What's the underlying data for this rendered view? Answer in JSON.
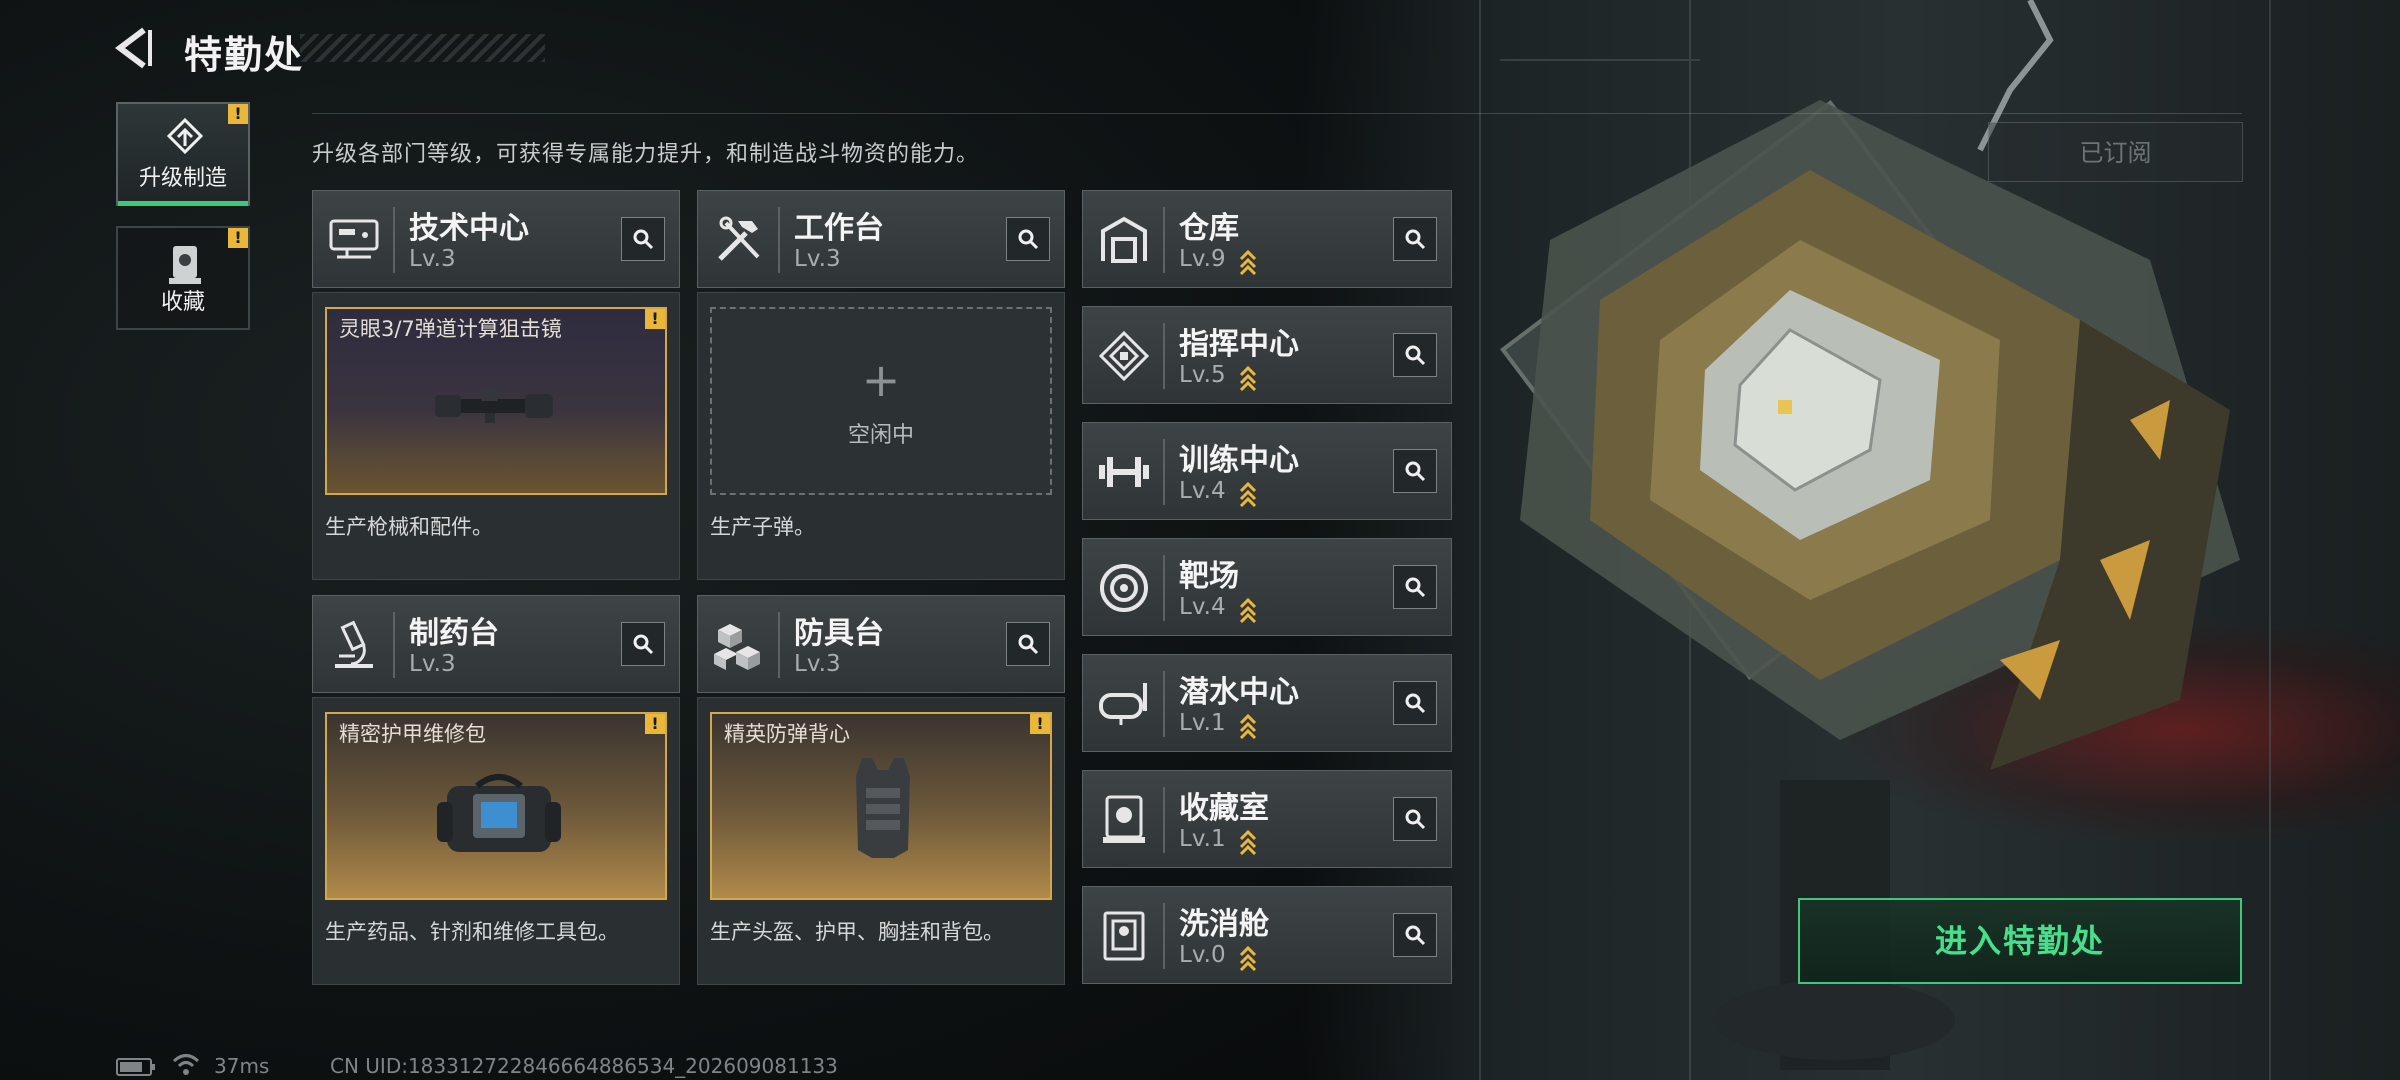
{
  "header": {
    "title": "特勤处"
  },
  "side_tabs": [
    {
      "label": "升级制造",
      "icon": "upgrade-icon",
      "active": true,
      "badge": "!"
    },
    {
      "label": "收藏",
      "icon": "collection-icon",
      "active": false,
      "badge": "!"
    }
  ],
  "hint": "升级各部门等级，可获得专属能力提升，和制造战斗物资的能力。",
  "subscribe_label": "已订阅",
  "departments_main": [
    {
      "name": "技术中心",
      "level": "Lv.3",
      "icon": "computer-terminal-icon",
      "slot": {
        "state": "crafting",
        "item_name": "灵眼3/7弹道计算狙击镜",
        "item_icon": "scope-icon",
        "badge": "!"
      },
      "desc": "生产枪械和配件。"
    },
    {
      "name": "工作台",
      "level": "Lv.3",
      "icon": "tools-icon",
      "slot": {
        "state": "idle",
        "plus": "+",
        "label": "空闲中"
      },
      "desc": "生产子弹。"
    },
    {
      "name": "制药台",
      "level": "Lv.3",
      "icon": "microscope-icon",
      "slot": {
        "state": "crafting",
        "item_name": "精密护甲维修包",
        "item_icon": "repair-kit-icon",
        "badge": "!"
      },
      "desc": "生产药品、针剂和维修工具包。"
    },
    {
      "name": "防具台",
      "level": "Lv.3",
      "icon": "cubes-icon",
      "slot": {
        "state": "crafting",
        "item_name": "精英防弹背心",
        "item_icon": "vest-icon",
        "badge": "!"
      },
      "desc": "生产头盔、护甲、胸挂和背包。"
    }
  ],
  "departments_list": [
    {
      "name": "仓库",
      "level": "Lv.9",
      "icon": "warehouse-icon"
    },
    {
      "name": "指挥中心",
      "level": "Lv.5",
      "icon": "command-center-icon"
    },
    {
      "name": "训练中心",
      "level": "Lv.4",
      "icon": "dumbbell-icon"
    },
    {
      "name": "靶场",
      "level": "Lv.4",
      "icon": "target-icon"
    },
    {
      "name": "潜水中心",
      "level": "Lv.1",
      "icon": "diving-mask-icon"
    },
    {
      "name": "收藏室",
      "level": "Lv.1",
      "icon": "display-case-icon"
    },
    {
      "name": "洗消舱",
      "level": "Lv.0",
      "icon": "decon-chamber-icon"
    }
  ],
  "enter_button": "进入特勤处",
  "status": {
    "ping": "37ms",
    "uid": "CN UID:18331272284666488653​4_202609081133"
  },
  "colors": {
    "accent_green": "#3ec97a",
    "badge_yellow": "#e9b73a",
    "slot_gold": "#d4a74b"
  }
}
